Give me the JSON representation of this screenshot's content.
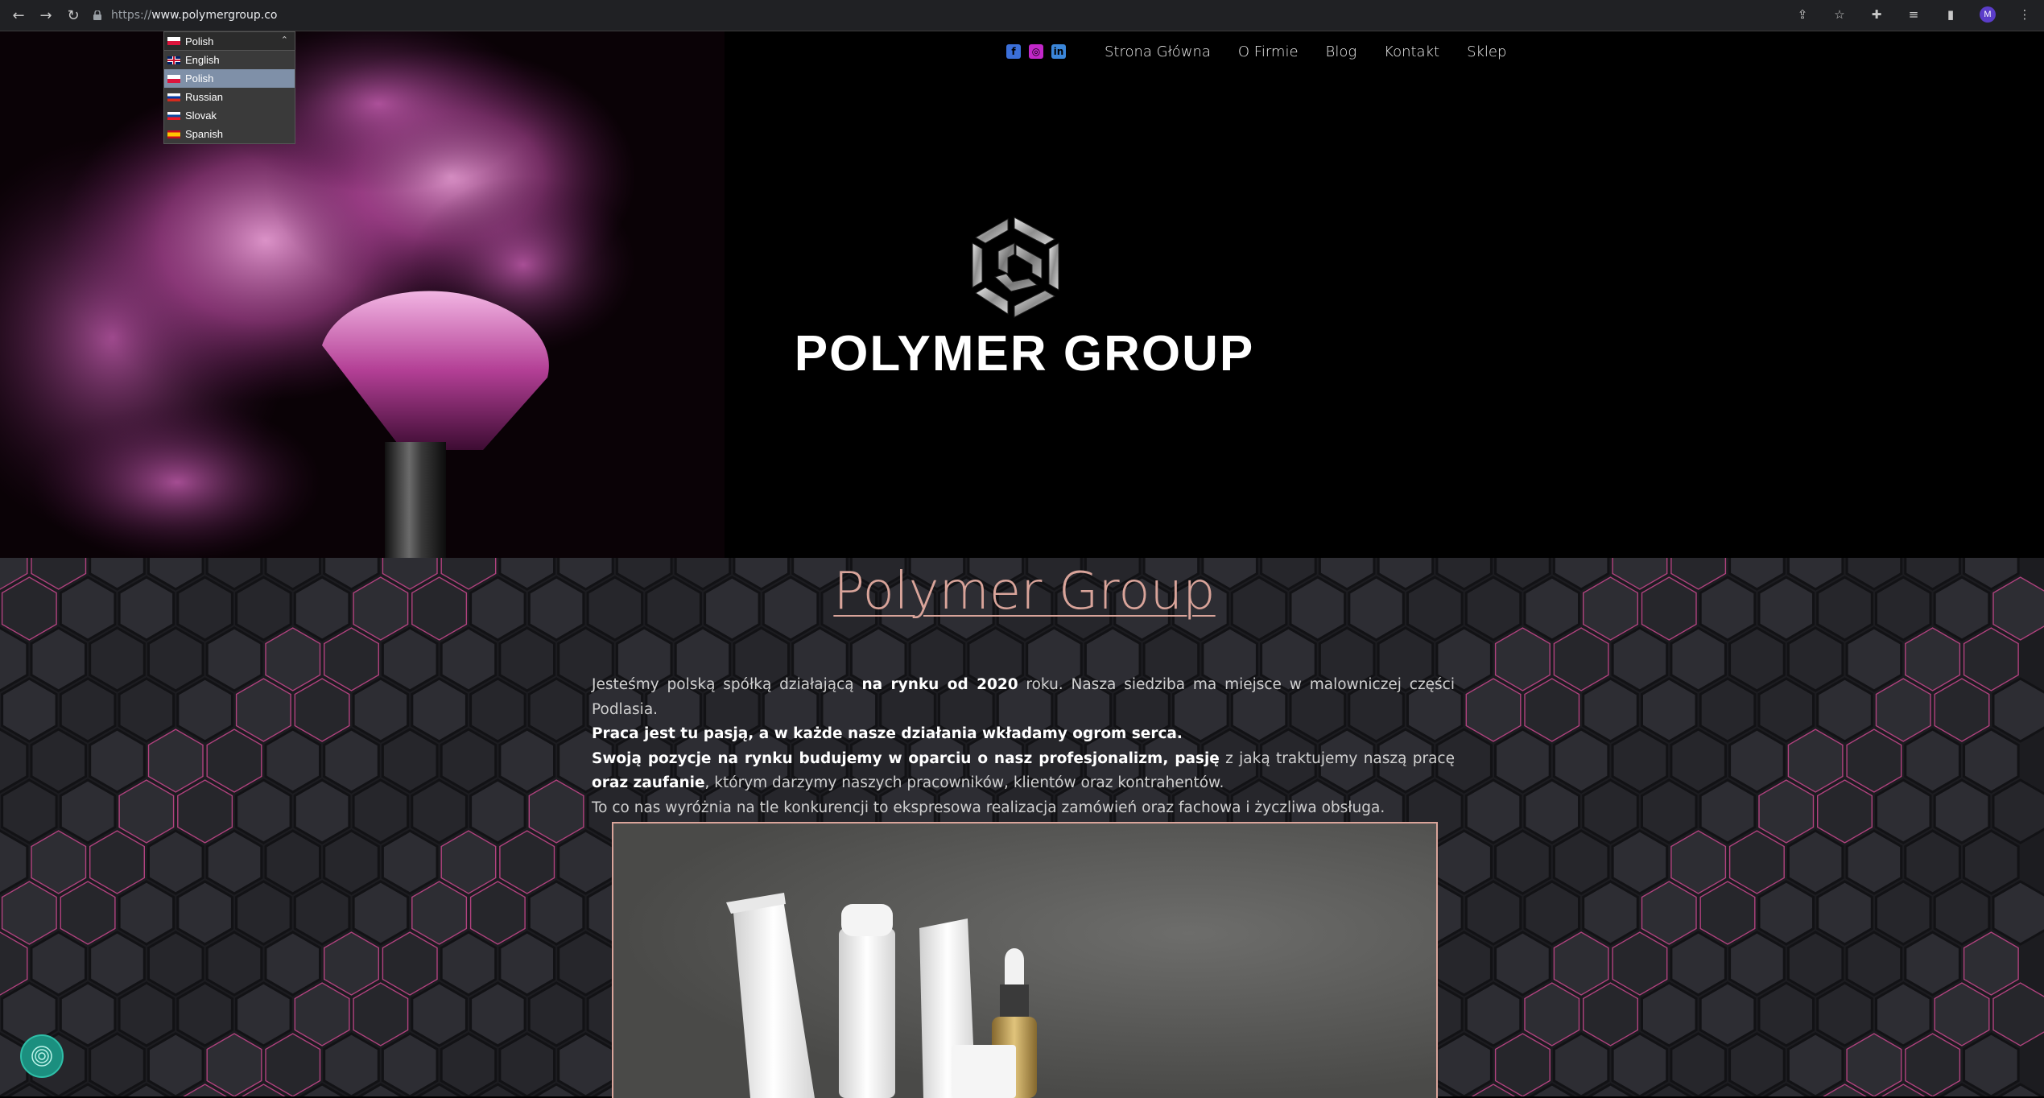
{
  "browser": {
    "url_scheme": "https://",
    "url_host": "www.polymergroup.co",
    "profile_initial": "M"
  },
  "language_select": {
    "selected": "Polish",
    "options": [
      {
        "label": "English",
        "flag": "uk-flag"
      },
      {
        "label": "Polish",
        "flag": "pl-flag",
        "active": true
      },
      {
        "label": "Russian",
        "flag": "ru-flag"
      },
      {
        "label": "Slovak",
        "flag": "sk-flag"
      },
      {
        "label": "Spanish",
        "flag": "es-flag"
      }
    ]
  },
  "nav": {
    "social": [
      "facebook-icon",
      "instagram-icon",
      "linkedin-icon"
    ],
    "items": [
      "Strona Główna",
      "O Firmie",
      "Blog",
      "Kontakt",
      "Sklep"
    ]
  },
  "hero": {
    "brand": "POLYMER GROUP"
  },
  "about": {
    "title": "Polymer Group",
    "p1_a": "Jesteśmy polską spółką działającą ",
    "p1_b": "na rynku od 2020",
    "p1_c": " roku. Nasza siedziba ma miejsce w malowniczej części Podlasia.",
    "p2": "Praca jest tu pasją, a w każde nasze działania wkładamy ogrom serca.",
    "p3_a": "Swoją pozycje na rynku budujemy w oparciu o nasz profesjonalizm, pasję",
    "p3_b": " z jaką traktujemy naszą pracę ",
    "p3_c": "oraz zaufanie",
    "p3_d": ", którym darzymy naszych pracowników, klientów oraz kontrahentów.",
    "p4": "To co nas wyróżnia na tle konkurencji to ekspresowa realizacja zamówień oraz fachowa i życzliwa obsługa."
  },
  "colors": {
    "accent": "#d9a49a",
    "background": "#000000",
    "hex_bg": "#1c1c20"
  }
}
